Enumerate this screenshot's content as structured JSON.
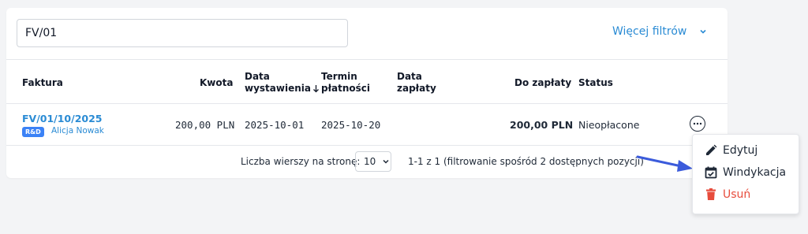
{
  "filters": {
    "search_value": "FV/01",
    "more_filters_label": "Więcej filtrów"
  },
  "table": {
    "headers": {
      "invoice": "Faktura",
      "amount": "Kwota",
      "issue_date_line1": "Data",
      "issue_date_line2": "wystawienia",
      "due_date_line1": "Termin",
      "due_date_line2": "płatności",
      "paid_date_line1": "Data",
      "paid_date_line2": "zapłaty",
      "to_pay": "Do zapłaty",
      "status": "Status"
    },
    "sort_icon": "arrow-down-icon",
    "rows": [
      {
        "invoice": "FV/01/10/2025",
        "badge": "R&D",
        "person": "Alicja Nowak",
        "amount": "200,00 PLN",
        "issue_date": "2025-10-01",
        "due_date": "2025-10-20",
        "paid_date": "",
        "to_pay": "200,00 PLN",
        "status": "Nieopłacone"
      }
    ]
  },
  "footer": {
    "rows_per_page_label": "Liczba wierszy na stronę:",
    "rows_per_page_value": "10",
    "pagination_text": "1-1 z 1 (filtrowanie spośród 2 dostępnych pozycji)"
  },
  "context_menu": {
    "items": [
      {
        "label": "Edytuj",
        "icon": "pencil-icon"
      },
      {
        "label": "Windykacja",
        "icon": "calendar-check-icon"
      },
      {
        "label": "Usuń",
        "icon": "trash-icon"
      }
    ]
  },
  "colors": {
    "accent": "#2a8bd4",
    "badge": "#3b82f6",
    "danger": "#e74c3c",
    "arrow": "#3b5bdb"
  }
}
